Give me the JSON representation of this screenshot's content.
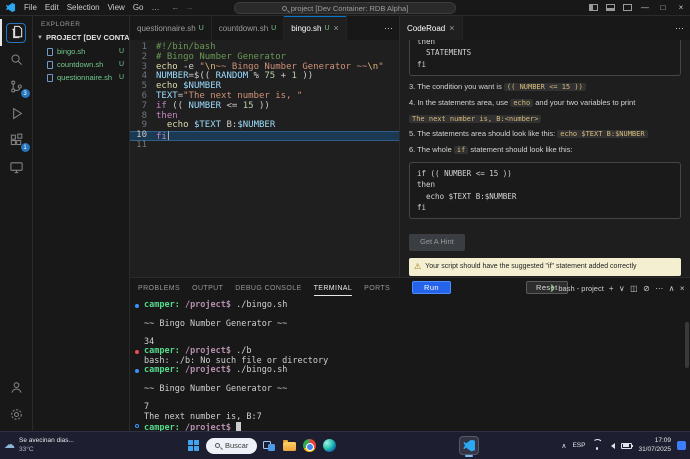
{
  "colors": {
    "accent": "#0078d4",
    "untracked": "#73c991",
    "error-red": "#f14c4c",
    "run-blue": "#2563eb"
  },
  "titlebar": {
    "menus": [
      "File",
      "Edit",
      "Selection",
      "View",
      "Go",
      "…"
    ],
    "title": "project [Dev Container: RDB Alpha]",
    "window_controls": [
      "minimize",
      "maximize",
      "close"
    ]
  },
  "activity_bar": {
    "source_control_badge": "3",
    "extensions_badge": "1"
  },
  "sidebar": {
    "title": "EXPLORER",
    "section": "PROJECT [DEV CONTAINER: RDB ALPHA]",
    "files": [
      {
        "name": "bingo.sh",
        "badge": "U"
      },
      {
        "name": "countdown.sh",
        "badge": "U"
      },
      {
        "name": "questionnaire.sh",
        "badge": "U"
      }
    ]
  },
  "editor": {
    "tabs": [
      {
        "label": "questionnaire.sh",
        "badge": "U",
        "active": false
      },
      {
        "label": "countdown.sh",
        "badge": "U",
        "active": false
      },
      {
        "label": "bingo.sh",
        "badge": "U",
        "active": true
      }
    ],
    "active_line": 10,
    "lines": [
      {
        "tokens": [
          [
            "#!/bin/bash",
            "cmt"
          ]
        ]
      },
      {
        "tokens": [
          [
            "# Bingo Number Generator",
            "cmt"
          ]
        ]
      },
      {
        "tokens": [
          [
            "echo",
            "fn"
          ],
          [
            " -e ",
            "pln"
          ],
          [
            "\"",
            "str"
          ],
          [
            "\\n",
            "esc"
          ],
          [
            "~~ Bingo Number Generator ~~",
            "str"
          ],
          [
            "\\n",
            "esc"
          ],
          [
            "\"",
            "str"
          ]
        ]
      },
      {
        "tokens": [
          [
            "NUMBER",
            "var"
          ],
          [
            "=$(( ",
            "pln"
          ],
          [
            "RANDOM",
            "var"
          ],
          [
            " % ",
            "pln"
          ],
          [
            "75",
            "num"
          ],
          [
            " + ",
            "pln"
          ],
          [
            "1",
            "num"
          ],
          [
            " ))",
            "pln"
          ]
        ]
      },
      {
        "tokens": [
          [
            "echo",
            "fn"
          ],
          [
            " ",
            "pln"
          ],
          [
            "$NUMBER",
            "var"
          ]
        ]
      },
      {
        "tokens": [
          [
            "TEXT",
            "var"
          ],
          [
            "=",
            "pln"
          ],
          [
            "\"The next number is, \"",
            "str"
          ]
        ]
      },
      {
        "tokens": [
          [
            "if",
            "kw"
          ],
          [
            " (( ",
            "pln"
          ],
          [
            "NUMBER",
            "var"
          ],
          [
            " <= ",
            "pln"
          ],
          [
            "15",
            "num"
          ],
          [
            " ))",
            "pln"
          ]
        ]
      },
      {
        "tokens": [
          [
            "then",
            "kw"
          ]
        ]
      },
      {
        "tokens": [
          [
            "  ",
            "pln"
          ],
          [
            "echo",
            "fn"
          ],
          [
            " ",
            "pln"
          ],
          [
            "$TEXT",
            "var"
          ],
          [
            " B:",
            "pln"
          ],
          [
            "$NUMBER",
            "var"
          ]
        ]
      },
      {
        "tokens": [
          [
            "fi",
            "kw"
          ]
        ]
      },
      {
        "tokens": []
      }
    ]
  },
  "coderoad": {
    "tab": "CodeRoad",
    "partial_block": [
      "then",
      "  STATEMENTS",
      "fi"
    ],
    "steps": [
      {
        "segments": [
          {
            "k": "t",
            "t": "3. The condition you want is "
          },
          {
            "k": "c",
            "t": "(( NUMBER <= 15 ))"
          }
        ]
      },
      {
        "segments": [
          {
            "k": "t",
            "t": "4. In the statements area, use "
          },
          {
            "k": "c",
            "t": "echo"
          },
          {
            "k": "t",
            "t": " and your two variables to print"
          }
        ]
      },
      {
        "segments": [
          {
            "k": "c",
            "t": "The next number is, B:<number>"
          }
        ]
      },
      {
        "segments": [
          {
            "k": "t",
            "t": "5. The statements area should look like this: "
          },
          {
            "k": "c",
            "t": "echo $TEXT B:$NUMBER"
          }
        ]
      },
      {
        "segments": [
          {
            "k": "t",
            "t": "6. The whole "
          },
          {
            "k": "c",
            "t": "if"
          },
          {
            "k": "t",
            "t": " statement should look like this:"
          }
        ]
      }
    ],
    "example_block": [
      "if (( NUMBER <= 15 ))",
      "then",
      "  echo $TEXT B:$NUMBER",
      "fi"
    ],
    "hint_button": "Get A Hint",
    "warning": "Your script should have the suggested \"if\" statement added correctly",
    "run_button": "Run",
    "reset_button": "Reset"
  },
  "panel": {
    "tabs": [
      "PROBLEMS",
      "OUTPUT",
      "DEBUG CONSOLE",
      "TERMINAL",
      "PORTS"
    ],
    "active_tab": "TERMINAL",
    "shell_label": "bash - project",
    "actions": [
      "new-terminal",
      "dropdown",
      "split",
      "kill",
      "more",
      "maximize",
      "close"
    ],
    "lines": [
      {
        "deco": "ok",
        "tokens": [
          [
            "camper:",
            "user"
          ],
          [
            " /project$",
            "path"
          ],
          [
            " ./bingo.sh",
            "pln"
          ]
        ]
      },
      {
        "tokens": []
      },
      {
        "tokens": [
          [
            "~~ Bingo Number Generator ~~",
            "pln"
          ]
        ]
      },
      {
        "tokens": []
      },
      {
        "tokens": [
          [
            "34",
            "pln"
          ]
        ]
      },
      {
        "deco": "err",
        "tokens": [
          [
            "camper:",
            "user"
          ],
          [
            " /project$",
            "path"
          ],
          [
            " ./b",
            "pln"
          ]
        ]
      },
      {
        "tokens": [
          [
            "bash: ./b: No such file or directory",
            "pln"
          ]
        ]
      },
      {
        "deco": "ok",
        "tokens": [
          [
            "camper:",
            "user"
          ],
          [
            " /project$",
            "path"
          ],
          [
            " ./bingo.sh",
            "pln"
          ]
        ]
      },
      {
        "tokens": []
      },
      {
        "tokens": [
          [
            "~~ Bingo Number Generator ~~",
            "pln"
          ]
        ]
      },
      {
        "tokens": []
      },
      {
        "tokens": [
          [
            "7",
            "pln"
          ]
        ]
      },
      {
        "tokens": [
          [
            "The next number is, B:7",
            "pln"
          ]
        ]
      },
      {
        "deco": "cur",
        "tokens": [
          [
            "camper:",
            "user"
          ],
          [
            " /project$ ",
            "path"
          ],
          [
            "",
            "cursor"
          ]
        ]
      }
    ]
  },
  "taskbar": {
    "weather_line1": "Se avecinan dias...",
    "weather_line2": "33°C",
    "search_label": "Buscar",
    "tray_language": "ESP",
    "time": "17:09",
    "date": "31/07/2025"
  }
}
